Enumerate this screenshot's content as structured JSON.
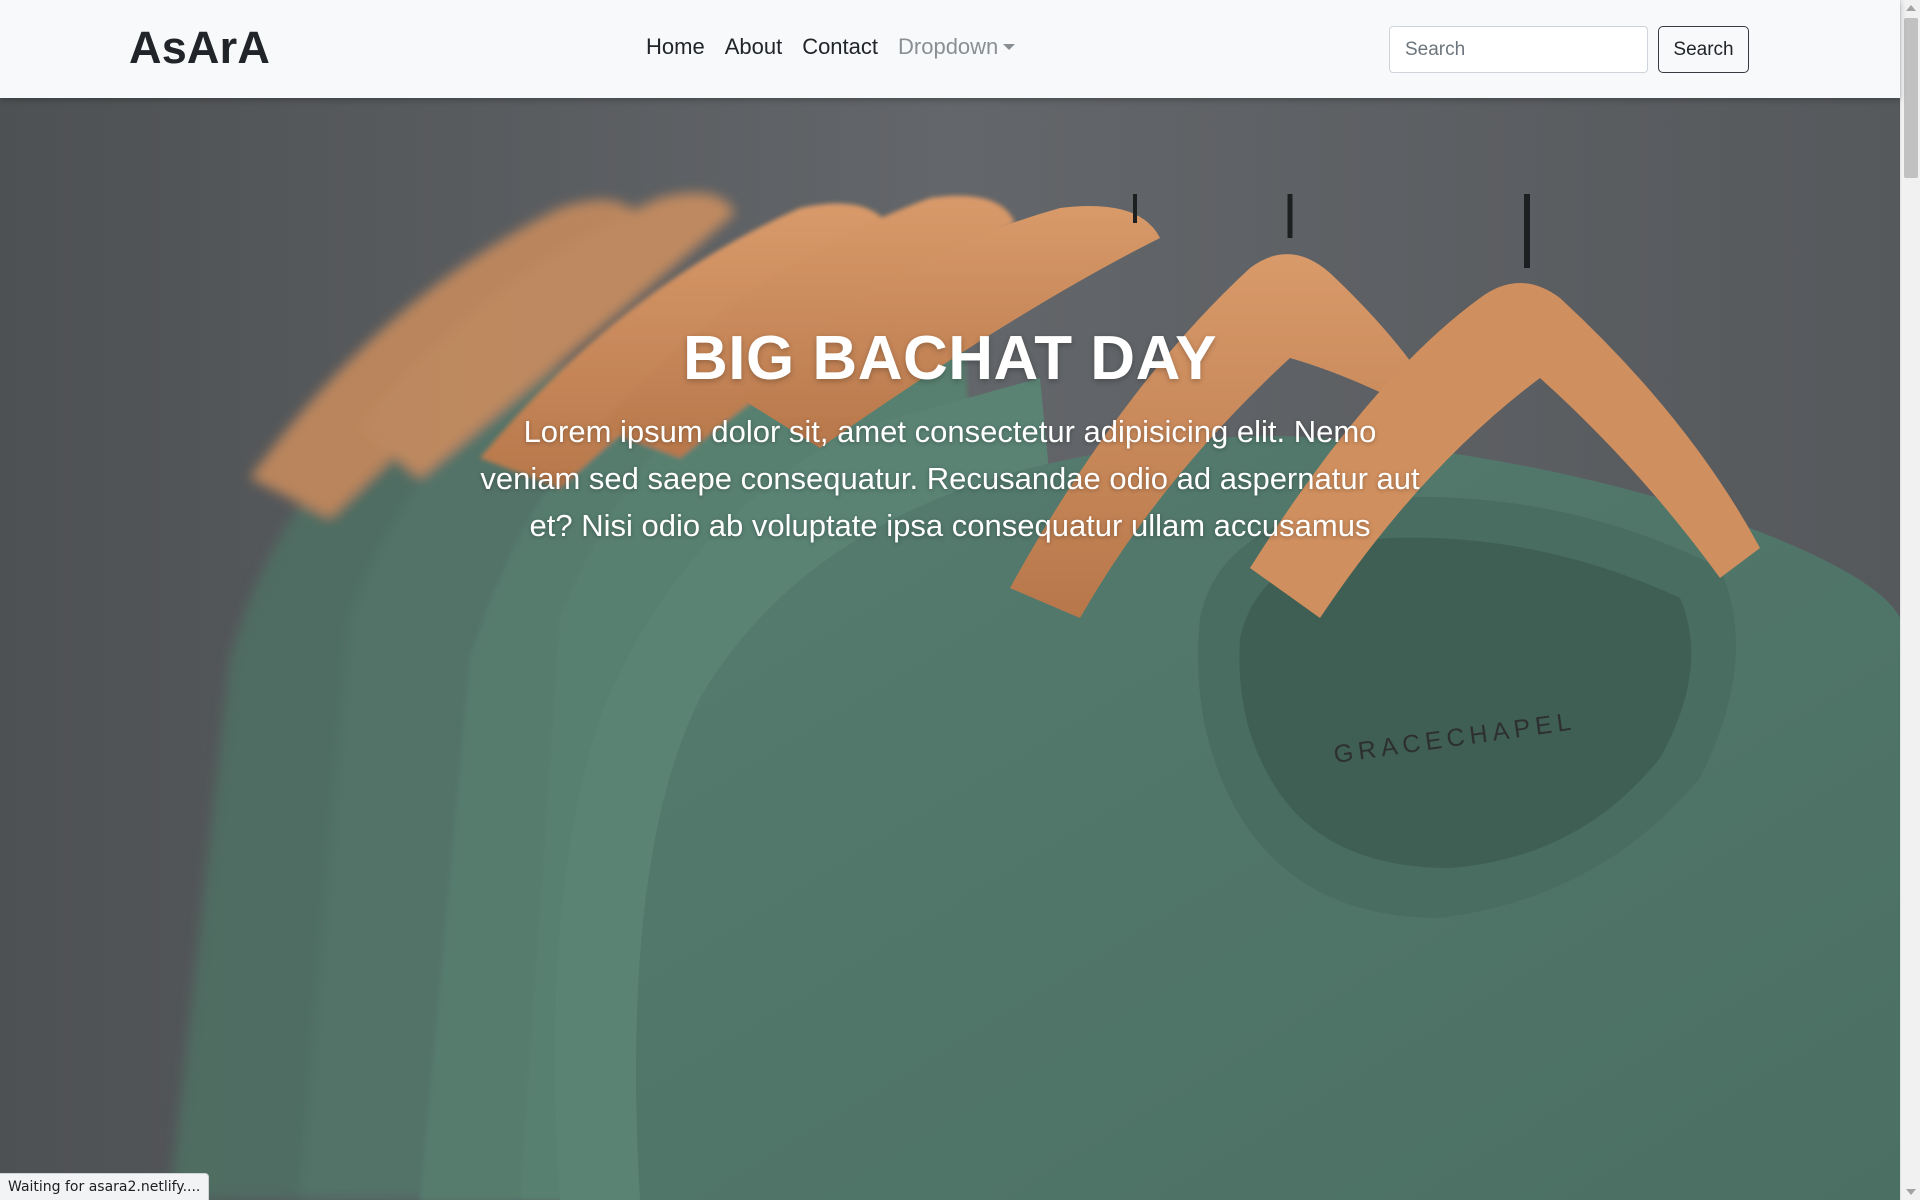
{
  "navbar": {
    "brand": "AsArA",
    "links": [
      {
        "label": "Home"
      },
      {
        "label": "About"
      },
      {
        "label": "Contact"
      },
      {
        "label": "Dropdown"
      }
    ],
    "search_placeholder": "Search",
    "search_button": "Search"
  },
  "hero": {
    "title": "BIG BACHAT DAY",
    "text": "Lorem ipsum dolor sit, amet consectetur adipisicing elit. Nemo veniam sed saepe consequatur. Recusandae odio ad aspernatur aut et? Nisi odio ab voluptate ipsa consequatur ullam accusamus",
    "image_label": "GRACECHAPEL"
  },
  "status_bar": {
    "text": "Waiting for asara2.netlify...."
  },
  "colors": {
    "navbar_bg": "#f8f9fa",
    "text_dark": "#212529",
    "nav_muted": "#8a8f94",
    "shirt_green": "#5c8476",
    "hanger_wood": "#c98a5a",
    "wall_gray": "#5f6264"
  },
  "icons": {
    "dropdown": "caret-down-icon"
  }
}
